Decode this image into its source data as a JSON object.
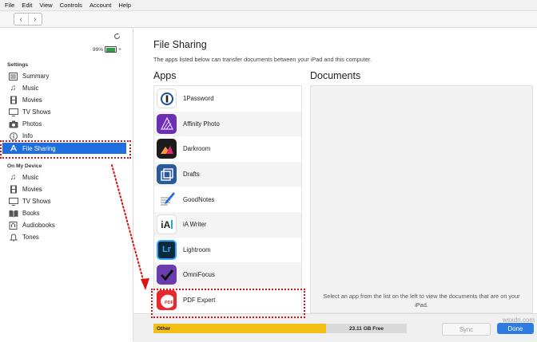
{
  "menu": [
    "File",
    "Edit",
    "View",
    "Controls",
    "Account",
    "Help"
  ],
  "device": {
    "battery_percent": "99%"
  },
  "sidebar": {
    "settings_header": "Settings",
    "settings_items": [
      {
        "label": "Summary",
        "icon": "summary-icon"
      },
      {
        "label": "Music",
        "icon": "music-note-icon"
      },
      {
        "label": "Movies",
        "icon": "film-icon"
      },
      {
        "label": "TV Shows",
        "icon": "tv-icon"
      },
      {
        "label": "Photos",
        "icon": "camera-icon"
      },
      {
        "label": "Info",
        "icon": "info-icon"
      },
      {
        "label": "File Sharing",
        "icon": "app-store-icon",
        "selected": true
      }
    ],
    "device_header": "On My Device",
    "device_items": [
      {
        "label": "Music",
        "icon": "music-note-icon"
      },
      {
        "label": "Movies",
        "icon": "film-icon"
      },
      {
        "label": "TV Shows",
        "icon": "tv-icon"
      },
      {
        "label": "Books",
        "icon": "book-icon"
      },
      {
        "label": "Audiobooks",
        "icon": "audiobook-icon"
      },
      {
        "label": "Tones",
        "icon": "bell-icon"
      }
    ]
  },
  "main": {
    "title": "File Sharing",
    "description": "The apps listed below can transfer documents between your iPad and this computer.",
    "apps_header": "Apps",
    "documents_header": "Documents",
    "apps": [
      {
        "name": "1Password",
        "icon": "onepassword-icon"
      },
      {
        "name": "Affinity Photo",
        "icon": "affinity-photo-icon"
      },
      {
        "name": "Darkroom",
        "icon": "darkroom-icon"
      },
      {
        "name": "Drafts",
        "icon": "drafts-icon"
      },
      {
        "name": "GoodNotes",
        "icon": "goodnotes-icon"
      },
      {
        "name": "iA Writer",
        "icon": "ia-writer-icon",
        "icon_text": "iA"
      },
      {
        "name": "Lightroom",
        "icon": "lightroom-icon",
        "icon_text": "Lr"
      },
      {
        "name": "OmniFocus",
        "icon": "omnifocus-icon"
      },
      {
        "name": "PDF Expert",
        "icon": "pdf-expert-icon",
        "icon_text": "PDF"
      }
    ],
    "documents_hint": "Select an app from the list on the left to view the documents that are on your iPad."
  },
  "footer": {
    "storage_other_label": "Other",
    "storage_free_label": "23.11 GB Free",
    "sync_label": "Sync",
    "done_label": "Done"
  },
  "watermark": "wsxdn.com",
  "colors": {
    "selection": "#1f6fe0",
    "storage_other": "#f5c016",
    "annotation": "#dd1111",
    "done_button": "#2f7de1"
  }
}
